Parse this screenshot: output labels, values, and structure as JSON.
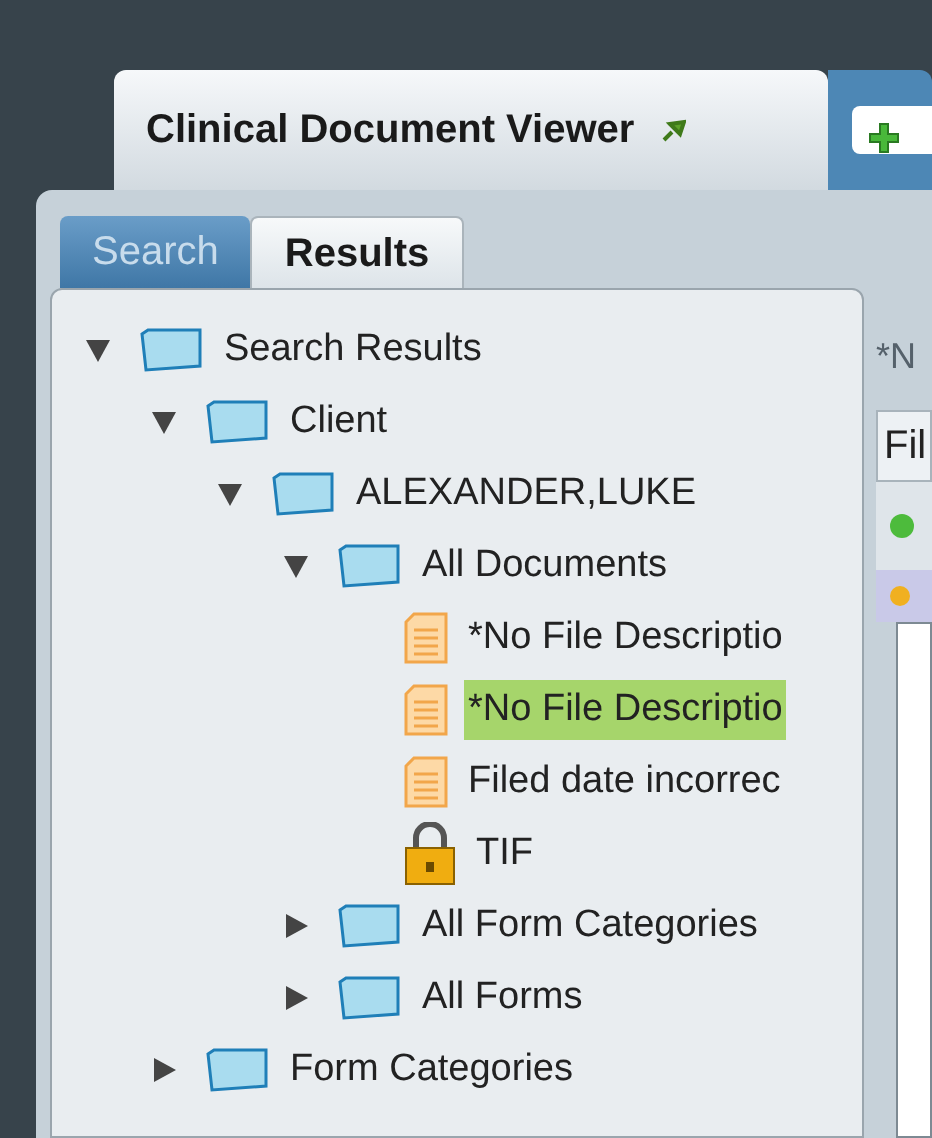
{
  "document_tab": {
    "title": "Clinical Document Viewer"
  },
  "panel_tabs": [
    {
      "label": "Search",
      "selected": false
    },
    {
      "label": "Results",
      "selected": true
    }
  ],
  "tree": [
    {
      "label": "Search Results",
      "kind": "folder",
      "expanded": true,
      "selected": false,
      "children": [
        {
          "label": "Client",
          "kind": "folder",
          "expanded": true,
          "selected": false,
          "children": [
            {
              "label": "ALEXANDER,LUKE",
              "kind": "folder",
              "expanded": true,
              "selected": false,
              "children": [
                {
                  "label": "All Documents",
                  "kind": "folder",
                  "expanded": true,
                  "selected": false,
                  "children": [
                    {
                      "label": "*No File Descriptio",
                      "kind": "document",
                      "selected": false
                    },
                    {
                      "label": "*No File Descriptio",
                      "kind": "document",
                      "selected": true
                    },
                    {
                      "label": "Filed date incorrec",
                      "kind": "document",
                      "selected": false
                    },
                    {
                      "label": "TIF",
                      "kind": "locked",
                      "selected": false
                    }
                  ]
                },
                {
                  "label": "All Form Categories",
                  "kind": "folder",
                  "expanded": false,
                  "selected": false
                },
                {
                  "label": "All Forms",
                  "kind": "folder",
                  "expanded": false,
                  "selected": false
                }
              ]
            }
          ]
        },
        {
          "label": "Form Categories",
          "kind": "folder",
          "expanded": false,
          "selected": false
        }
      ]
    }
  ],
  "right_pane": {
    "title": "*N",
    "header": "Fil"
  }
}
